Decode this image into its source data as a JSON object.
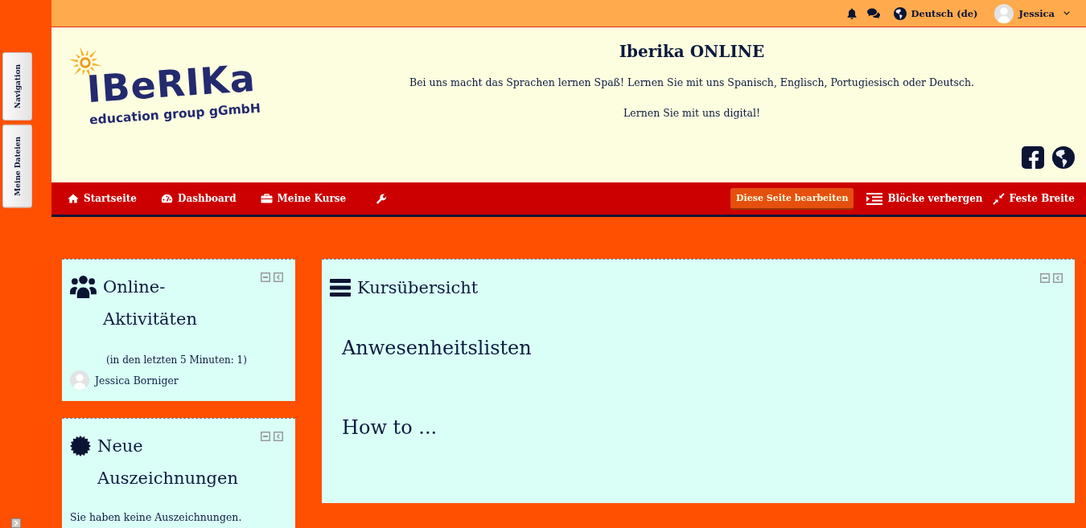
{
  "side_dock": {
    "tabs": [
      {
        "label": "Navigation"
      },
      {
        "label": "Meine Dateien"
      }
    ]
  },
  "top_bar": {
    "language": "Deutsch (de)",
    "user": "Jessica"
  },
  "header": {
    "logo": {
      "wordmark": "IBeRIKa",
      "tagline": "education group gGmbH"
    },
    "title": "Iberika ONLINE",
    "lines": [
      "Bei uns macht das Sprachen lernen Spaß! Lernen Sie mit uns Spanisch, Englisch, Portugiesisch oder Deutsch.",
      "Lernen Sie mit uns digital!"
    ]
  },
  "nav": {
    "items": [
      {
        "label": "Startseite"
      },
      {
        "label": "Dashboard"
      },
      {
        "label": "Meine Kurse"
      }
    ],
    "edit_button": "Diese Seite bearbeiten",
    "actions": [
      {
        "label": "Blöcke verbergen"
      },
      {
        "label": "Feste Breite"
      }
    ]
  },
  "left_blocks": [
    {
      "kind": "online_users",
      "title": "Online-Aktivitäten",
      "note": "(in den letzten 5 Minuten: 1)",
      "users": [
        {
          "name": "Jessica Borniger"
        }
      ]
    },
    {
      "kind": "badges",
      "title": "Neue Auszeichnungen",
      "message": "Sie haben keine Auszeichnungen."
    }
  ],
  "main_block": {
    "title": "Kursübersicht",
    "courses": [
      {
        "name": "Anwesenheitslisten"
      },
      {
        "name": "How to ..."
      }
    ]
  }
}
